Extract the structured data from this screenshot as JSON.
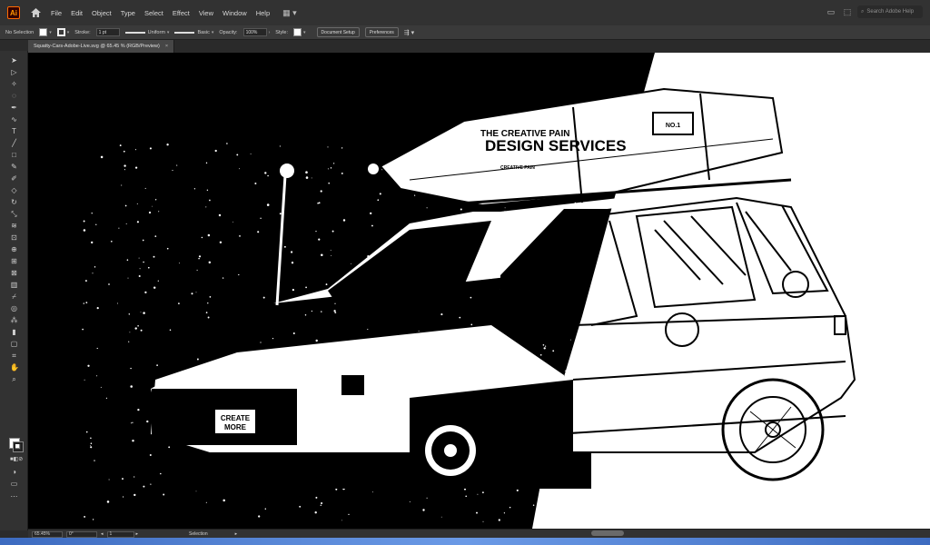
{
  "app": {
    "logo_text": "Ai",
    "menu": [
      "File",
      "Edit",
      "Object",
      "Type",
      "Select",
      "Effect",
      "View",
      "Window",
      "Help"
    ],
    "search_placeholder": "Search Adobe Help"
  },
  "control_bar": {
    "selection_status": "No Selection",
    "stroke_label": "Stroke:",
    "stroke_weight": "1 pt",
    "profile_label": "Uniform",
    "brush_label": "Basic",
    "opacity_label": "Opacity:",
    "opacity_value": "100%",
    "style_label": "Style:",
    "document_setup_button": "Document Setup",
    "preferences_button": "Preferences"
  },
  "document": {
    "tab_title": "Squatty-Cars-Adobe-Live.svg @ 65.45 % (RGB/Preview)",
    "close_glyph": "×"
  },
  "artwork": {
    "roof_text_line1": "THE CREATIVE PAIN",
    "roof_text_line2": "DESIGN SERVICES",
    "roof_badge": "NO.1",
    "roof_small": "CREATIVE PAIN",
    "plate_line1": "CREATE",
    "plate_line2": "MORE"
  },
  "status_bar": {
    "zoom": "65.45%",
    "rotation": "0°",
    "artboard": "1",
    "tool_name": "Selection"
  },
  "icons": {
    "tools": [
      "selection-icon",
      "direct-selection-icon",
      "magic-wand-icon",
      "lasso-icon",
      "pen-icon",
      "curvature-icon",
      "type-icon",
      "line-icon",
      "rectangle-icon",
      "paintbrush-icon",
      "shaper-icon",
      "eraser-icon",
      "rotate-icon",
      "scale-icon",
      "warp-icon",
      "free-transform-icon",
      "shape-builder-icon",
      "perspective-icon",
      "mesh-icon",
      "gradient-icon",
      "eyedropper-icon",
      "blend-icon",
      "symbol-sprayer-icon",
      "column-graph-icon",
      "artboard-icon",
      "slice-icon",
      "hand-icon",
      "zoom-icon"
    ]
  }
}
